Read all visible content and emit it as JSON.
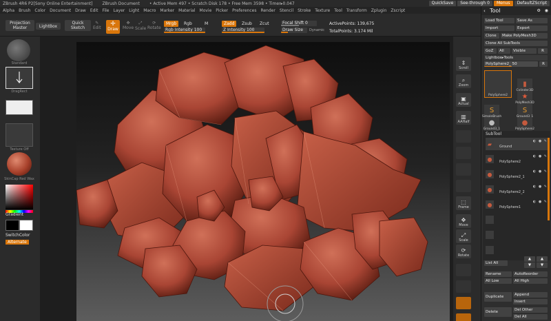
{
  "titlebar": {
    "app": "ZBrush 4R6 P2[Sony Online Entertainment]",
    "document": "ZBrush Document",
    "active_mem": "• Active Mem 497",
    "scratch_disk": "• Scratch Disk 178",
    "free_mem": "• Free Mem 3598",
    "timer": "• Timer▸0.047"
  },
  "topright": {
    "quicksave": "QuickSave",
    "seethrough": "See-through  0",
    "menus": "Menus",
    "defaultscript": "DefaultZScript"
  },
  "menus": [
    "Alpha",
    "Brush",
    "Color",
    "Document",
    "Draw",
    "Edit",
    "File",
    "Layer",
    "Light",
    "Macro",
    "Marker",
    "Material",
    "Movie",
    "Picker",
    "Preferences",
    "Render",
    "Stencil",
    "Stroke",
    "Texture",
    "Tool",
    "Transform",
    "Zplugin",
    "Zscript"
  ],
  "toolbar": {
    "projection_master": "Projection Master",
    "lightbox": "LightBox",
    "quick_sketch": "Quick Sketch",
    "edit": "Edit",
    "draw": "Draw",
    "move": "Move",
    "scale": "Scale",
    "rotate": "Rotate",
    "mrgb": "Mrgb",
    "rgb": "Rgb",
    "m": "M",
    "zadd": "Zadd",
    "zsub": "Zsub",
    "zcut": "Zcut",
    "rgb_intensity": "Rgb Intensity 100",
    "z_intensity": "Z Intensity 100",
    "focal_shift": "Focal Shift 0",
    "draw_size": "Draw Size 64",
    "dynamic": "Dynamic",
    "active_points": "ActivePoints: 139,675",
    "total_points": "TotalPoints: 3.174 Mil"
  },
  "toolbar_levels": {
    "rgb_intensity": 100,
    "z_intensity": 100,
    "focal_shift": 0,
    "draw_size": 64
  },
  "left": {
    "standard": "Standard",
    "dragrect": "DragRect",
    "texture_off": "Texture Off",
    "matcap": "SkinCap Red Wax",
    "gradient": "Gradient",
    "switchcolor": "SwitchColor",
    "alternate": "Alternate"
  },
  "rightshelf": [
    "Scroll",
    "Zoom",
    "Actual",
    "AAHalf",
    "Frame",
    "Move",
    "Scale",
    "Rotate"
  ],
  "toolpanel": {
    "title": "Tool",
    "load_tool": "Load Tool",
    "save_as": "Save As",
    "import": "Import",
    "export": "Export",
    "clone": "Clone",
    "make_polymesh3d": "Make PolyMesh3D",
    "clone_all_subtools": "Clone All SubTools",
    "goz": "GoZ",
    "all": "All",
    "visible": "Visible",
    "r": "R",
    "lightbox_tools": "Lightbox▸Tools",
    "polysphere_slider": "PolySphere2_ 50",
    "r2": "R",
    "thumbs": [
      {
        "label": "PolySphere2",
        "icon": ""
      },
      {
        "label": "Cylinder3D",
        "icon": "▮"
      },
      {
        "label": "PolyMesh3D",
        "icon": "★"
      },
      {
        "label": "SimpleBrush",
        "icon": "S"
      },
      {
        "label": "Ground3_1",
        "icon": "S"
      },
      {
        "label": "Ground3_1",
        "icon": "●"
      },
      {
        "label": "PolySphere2",
        "icon": "●"
      }
    ],
    "subtool_header": "SubTool",
    "subtools": [
      "Ground",
      "PolySphere2",
      "PolySphere2_1",
      "PolySphere2_2",
      "PolySphere1",
      "",
      "",
      ""
    ],
    "list_all": "List All",
    "rename": "Rename",
    "autoreorder": "AutoReorder",
    "all_low": "All Low",
    "all_high": "All High",
    "duplicate": "Duplicate",
    "append": "Append",
    "insert": "Insert",
    "delete": "Delete",
    "del_other": "Del Other",
    "del_all": "Del All"
  },
  "colors": {
    "accent": "#d9760b",
    "clay": "#b8503a",
    "panel": "#2e2e2e"
  }
}
